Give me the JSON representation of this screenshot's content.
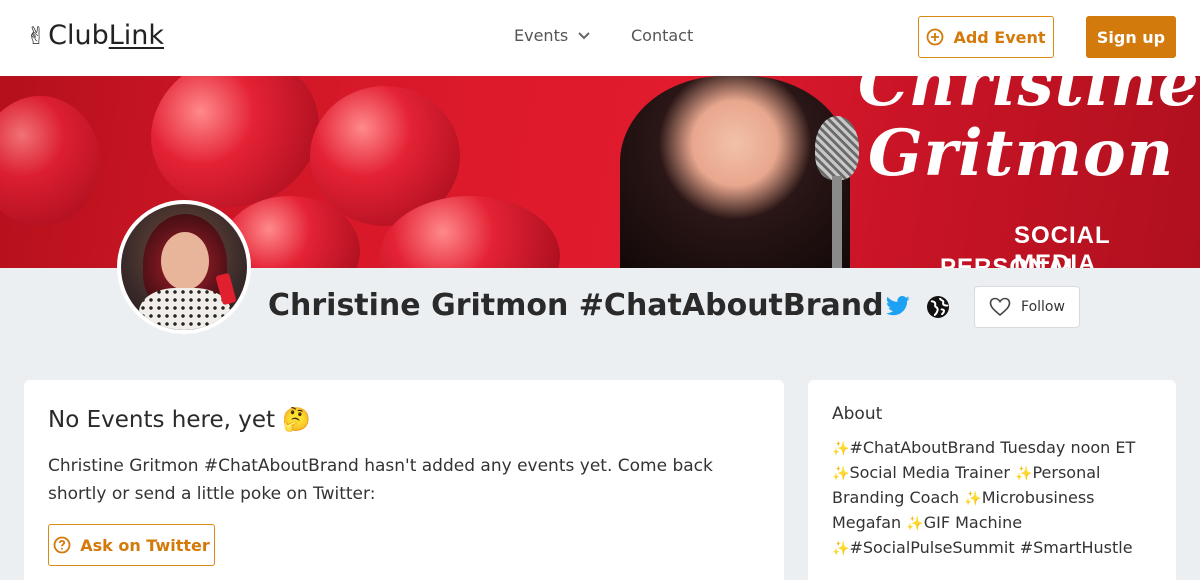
{
  "header": {
    "logo_emoji": "✌",
    "logo_club": "Club",
    "logo_link": "Link",
    "nav_events": "Events",
    "nav_contact": "Contact",
    "add_event_label": "Add Event",
    "signup_label": "Sign up"
  },
  "banner": {
    "script_line1": "Christine",
    "script_line2": "Gritmon",
    "subtitle1": "SOCIAL MEDIA",
    "subtitle2": "PERSONAL BRANDING"
  },
  "profile": {
    "name": "Christine Gritmon #ChatAboutBrand",
    "follow_label": "Follow"
  },
  "events": {
    "title": "No Events here, yet 🤔",
    "text": "Christine Gritmon #ChatAboutBrand hasn't added any events yet. Come back shortly or send a little poke on Twitter:",
    "ask_label": "Ask on Twitter"
  },
  "about": {
    "title": "About",
    "items": [
      "#ChatAboutBrand Tuesday noon ET",
      "Social Media Trainer",
      "Personal Branding Coach",
      "Microbusiness Megafan",
      "GIF Machine",
      "#SocialPulseSummit"
    ],
    "trailing": "#SmartHustle"
  },
  "colors": {
    "accent": "#d37a0d",
    "twitter": "#1da1f2",
    "banner_red": "#d8192a"
  },
  "icons": [
    "chevron-down-icon",
    "plus-circle-icon",
    "twitter-icon",
    "globe-icon",
    "heart-icon",
    "question-circle-icon",
    "sparkle-icon"
  ]
}
